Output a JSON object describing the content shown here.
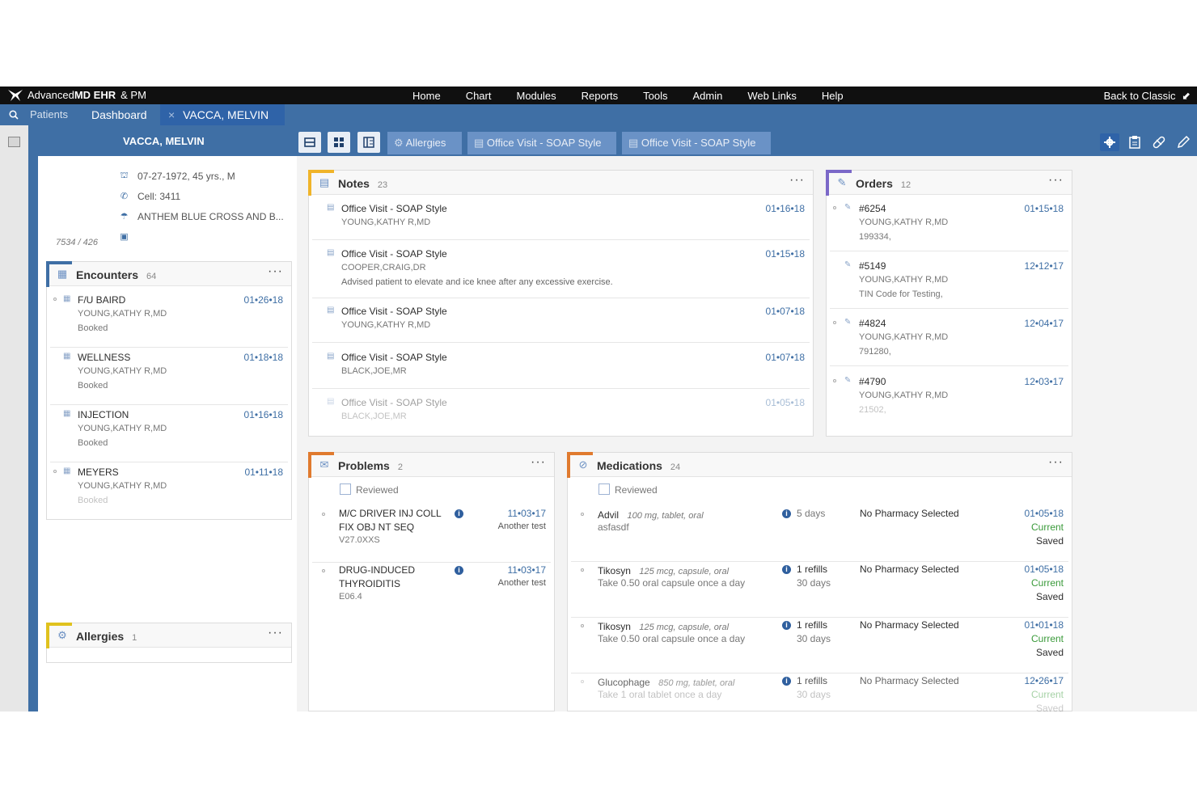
{
  "app": {
    "brand_prefix": "Advanced",
    "brand_bold": "MD EHR",
    "brand_suffix": "& PM",
    "menu": [
      "Home",
      "Chart",
      "Modules",
      "Reports",
      "Tools",
      "Admin",
      "Web Links",
      "Help"
    ],
    "back_label": "Back to Classic"
  },
  "tabs": {
    "patients": "Patients",
    "dashboard": "Dashboard",
    "close": "×",
    "active_patient": "VACCA, MELVIN"
  },
  "patient": {
    "name": "VACCA, MELVIN",
    "dob": "07-27-1972, 45 yrs., M",
    "cell": "Cell: 3411",
    "insurance": "ANTHEM BLUE CROSS AND B...",
    "id": "7534 / 426"
  },
  "view_tabs": [
    "Allergies",
    "Office Visit - SOAP Style",
    "Office Visit - SOAP Style"
  ],
  "encounters": {
    "title": "Encounters",
    "count": "64",
    "items": [
      {
        "title": "F/U BAIRD",
        "provider": "YOUNG,KATHY R,MD",
        "status": "Booked",
        "date": "01•26•18"
      },
      {
        "title": "WELLNESS",
        "provider": "YOUNG,KATHY R,MD",
        "status": "Booked",
        "date": "01•18•18"
      },
      {
        "title": "INJECTION",
        "provider": "YOUNG,KATHY R,MD",
        "status": "Booked",
        "date": "01•16•18"
      },
      {
        "title": "MEYERS",
        "provider": "YOUNG,KATHY R,MD",
        "status": "Booked",
        "date": "01•11•18"
      }
    ]
  },
  "allergies": {
    "title": "Allergies",
    "count": "1"
  },
  "notes": {
    "title": "Notes",
    "count": "23",
    "items": [
      {
        "title": "Office Visit - SOAP Style",
        "provider": "YOUNG,KATHY R,MD",
        "note": "",
        "date": "01•16•18"
      },
      {
        "title": "Office Visit - SOAP Style",
        "provider": "COOPER,CRAIG,DR",
        "note": "Advised patient to elevate and ice knee after any excessive exercise.",
        "date": "01•15•18"
      },
      {
        "title": "Office Visit - SOAP Style",
        "provider": "YOUNG,KATHY R,MD",
        "note": "",
        "date": "01•07•18"
      },
      {
        "title": "Office Visit - SOAP Style",
        "provider": "BLACK,JOE,MR",
        "note": "",
        "date": "01•07•18"
      },
      {
        "title": "Office Visit - SOAP Style",
        "provider": "BLACK,JOE,MR",
        "note": "",
        "date": "01•05•18"
      }
    ]
  },
  "orders": {
    "title": "Orders",
    "count": "12",
    "items": [
      {
        "num": "#6254",
        "provider": "YOUNG,KATHY R,MD",
        "detail": "199334,",
        "date": "01•15•18"
      },
      {
        "num": "#5149",
        "provider": "YOUNG,KATHY R,MD",
        "detail": "TIN Code for Testing,",
        "date": "12•12•17"
      },
      {
        "num": "#4824",
        "provider": "YOUNG,KATHY R,MD",
        "detail": "791280,",
        "date": "12•04•17"
      },
      {
        "num": "#4790",
        "provider": "YOUNG,KATHY R,MD",
        "detail": "21502,",
        "date": "12•03•17"
      }
    ]
  },
  "problems": {
    "title": "Problems",
    "count": "2",
    "reviewed": "Reviewed",
    "items": [
      {
        "line1": "M/C DRIVER INJ COLL",
        "line2": "FIX OBJ NT SEQ",
        "code": "V27.0XXS",
        "date": "11•03•17",
        "note": "Another test"
      },
      {
        "line1": "DRUG-INDUCED",
        "line2": "THYROIDITIS",
        "code": "E06.4",
        "date": "11•03•17",
        "note": "Another test"
      }
    ]
  },
  "medications": {
    "title": "Medications",
    "count": "24",
    "reviewed": "Reviewed",
    "items": [
      {
        "name": "Advil",
        "dose": "100 mg, tablet, oral",
        "sig": "asfasdf",
        "refill1": "5 days",
        "refill2": "",
        "pharmacy": "No Pharmacy Selected",
        "date": "01•05•18",
        "status": "Current",
        "saved": "Saved"
      },
      {
        "name": "Tikosyn",
        "dose": "125 mcg, capsule, oral",
        "sig": "Take 0.50 oral capsule once a day",
        "refill1": "1 refills",
        "refill2": "30 days",
        "pharmacy": "No Pharmacy Selected",
        "date": "01•05•18",
        "status": "Current",
        "saved": "Saved"
      },
      {
        "name": "Tikosyn",
        "dose": "125 mcg, capsule, oral",
        "sig": "Take 0.50 oral capsule once a day",
        "refill1": "1 refills",
        "refill2": "30 days",
        "pharmacy": "No Pharmacy Selected",
        "date": "01•01•18",
        "status": "Current",
        "saved": "Saved"
      },
      {
        "name": "Glucophage",
        "dose": "850 mg, tablet, oral",
        "sig": "Take 1 oral tablet once a day",
        "refill1": "1 refills",
        "refill2": "30 days",
        "pharmacy": "No Pharmacy Selected",
        "date": "12•26•17",
        "status": "Current",
        "saved": "Saved"
      }
    ]
  },
  "colors": {
    "blue": "#3f6fa5",
    "dark_blue": "#2f63a8",
    "notes_accent": "#f0b429",
    "orders_accent": "#7b68c8",
    "problems_accent": "#e07a2e",
    "allergies_accent": "#e0c21e",
    "encounters_accent": "#3f6fa5",
    "green": "#3a9a3a"
  },
  "icons": [
    "calendar-icon",
    "phone-icon",
    "umbrella-icon",
    "card-icon",
    "gear-icon",
    "clipboard-icon",
    "pill-icon",
    "pencil-icon",
    "grid-icon",
    "list-icon",
    "columns-icon",
    "search-icon",
    "info-icon"
  ]
}
